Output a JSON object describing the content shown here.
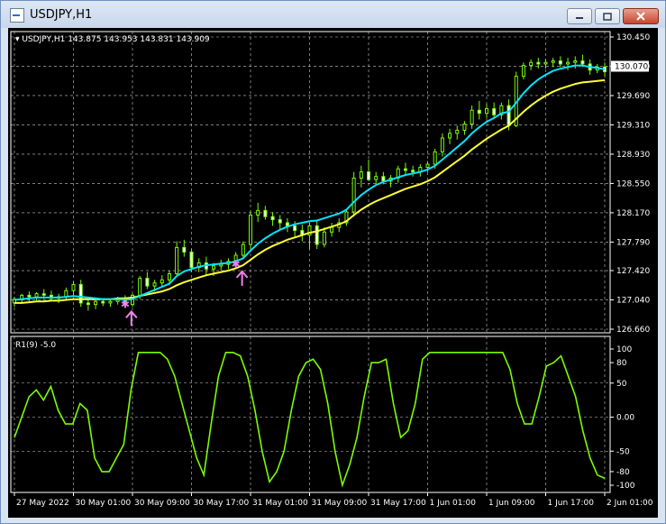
{
  "window": {
    "title": "USDJPY,H1",
    "controls": [
      "minimize",
      "maximize",
      "close"
    ]
  },
  "chart": {
    "info": "USDJPY,H1  143.875 143.953 143.831 143.909",
    "price_ticks": [
      "130.450",
      "130.070",
      "129.690",
      "129.310",
      "128.930",
      "128.550",
      "128.170",
      "127.790",
      "127.420",
      "127.040",
      "126.660"
    ],
    "current_price": "130.070",
    "indicator_label": "R1(9) -5.0",
    "indicator_ticks": [
      "100",
      "80",
      "50",
      "0.00",
      "-50",
      "-80",
      "-100"
    ],
    "time_ticks": [
      "27 May 2022",
      "30 May 01:00",
      "30 May 09:00",
      "30 May 17:00",
      "31 May 01:00",
      "31 May 09:00",
      "31 May 17:00",
      "1 Jun 01:00",
      "1 Jun 09:00",
      "1 Jun 17:00",
      "2 Jun 01:00"
    ],
    "colors": {
      "background": "#000000",
      "grid": "#c8c8c8",
      "candle": "#7cfc00",
      "ma_fast": "#00e5ff",
      "ma_slow": "#ffff33",
      "signal": "#ee82ee",
      "indicator_line": "#7cfc00"
    },
    "signals": [
      {
        "type": "buy-arrow",
        "near": "30 May 09:00"
      },
      {
        "type": "buy-arrow",
        "near": "30 May 17:00"
      }
    ]
  },
  "chart_data": {
    "type": "candlestick",
    "symbol": "USDJPY",
    "timeframe": "H1",
    "ylim": [
      126.66,
      130.45
    ],
    "ohlc": [
      [
        127.0,
        127.08,
        126.95,
        127.05
      ],
      [
        127.05,
        127.12,
        127.0,
        127.1
      ],
      [
        127.1,
        127.15,
        127.02,
        127.08
      ],
      [
        127.08,
        127.14,
        127.03,
        127.12
      ],
      [
        127.12,
        127.18,
        127.05,
        127.1
      ],
      [
        127.1,
        127.16,
        127.02,
        127.06
      ],
      [
        127.06,
        127.12,
        127.0,
        127.08
      ],
      [
        127.08,
        127.2,
        127.04,
        127.16
      ],
      [
        127.16,
        127.28,
        127.1,
        127.24
      ],
      [
        127.24,
        127.3,
        126.95,
        127.0
      ],
      [
        127.0,
        127.06,
        126.9,
        126.98
      ],
      [
        126.98,
        127.05,
        126.92,
        127.02
      ],
      [
        127.02,
        127.06,
        126.96,
        127.0
      ],
      [
        127.0,
        127.05,
        126.95,
        127.02
      ],
      [
        127.02,
        127.08,
        126.98,
        127.04
      ],
      [
        127.04,
        127.1,
        126.96,
        126.98
      ],
      [
        126.98,
        127.12,
        126.95,
        127.1
      ],
      [
        127.1,
        127.35,
        127.05,
        127.32
      ],
      [
        127.32,
        127.4,
        127.18,
        127.22
      ],
      [
        127.22,
        127.3,
        127.15,
        127.26
      ],
      [
        127.26,
        127.36,
        127.2,
        127.3
      ],
      [
        127.3,
        127.42,
        127.24,
        127.38
      ],
      [
        127.38,
        127.8,
        127.34,
        127.72
      ],
      [
        127.72,
        127.82,
        127.6,
        127.66
      ],
      [
        127.66,
        127.7,
        127.4,
        127.46
      ],
      [
        127.46,
        127.58,
        127.4,
        127.52
      ],
      [
        127.52,
        127.6,
        127.36,
        127.44
      ],
      [
        127.44,
        127.52,
        127.35,
        127.48
      ],
      [
        127.48,
        127.56,
        127.42,
        127.5
      ],
      [
        127.5,
        127.58,
        127.44,
        127.54
      ],
      [
        127.54,
        127.66,
        127.48,
        127.62
      ],
      [
        127.62,
        127.8,
        127.58,
        127.76
      ],
      [
        127.76,
        128.2,
        127.7,
        128.14
      ],
      [
        128.14,
        128.3,
        128.05,
        128.2
      ],
      [
        128.2,
        128.26,
        128.08,
        128.12
      ],
      [
        128.12,
        128.18,
        128.0,
        128.08
      ],
      [
        128.08,
        128.14,
        127.96,
        128.04
      ],
      [
        128.04,
        128.1,
        127.92,
        128.0
      ],
      [
        128.0,
        128.06,
        127.86,
        127.94
      ],
      [
        127.94,
        128.02,
        127.8,
        127.88
      ],
      [
        127.88,
        128.04,
        127.7,
        128.0
      ],
      [
        128.0,
        128.06,
        127.7,
        127.76
      ],
      [
        127.76,
        127.98,
        127.72,
        127.92
      ],
      [
        127.92,
        128.04,
        127.86,
        127.98
      ],
      [
        127.98,
        128.1,
        127.92,
        128.04
      ],
      [
        128.04,
        128.22,
        128.0,
        128.18
      ],
      [
        128.18,
        128.7,
        128.12,
        128.62
      ],
      [
        128.62,
        128.78,
        128.5,
        128.7
      ],
      [
        128.7,
        128.86,
        128.58,
        128.6
      ],
      [
        128.6,
        128.7,
        128.52,
        128.64
      ],
      [
        128.64,
        128.7,
        128.54,
        128.58
      ],
      [
        128.58,
        128.66,
        128.5,
        128.62
      ],
      [
        128.62,
        128.78,
        128.56,
        128.74
      ],
      [
        128.74,
        128.82,
        128.66,
        128.72
      ],
      [
        128.72,
        128.78,
        128.64,
        128.7
      ],
      [
        128.7,
        128.8,
        128.64,
        128.76
      ],
      [
        128.76,
        128.84,
        128.7,
        128.8
      ],
      [
        128.8,
        129.0,
        128.74,
        128.96
      ],
      [
        128.96,
        129.2,
        128.9,
        129.14
      ],
      [
        129.14,
        129.26,
        129.06,
        129.2
      ],
      [
        129.2,
        129.3,
        129.12,
        129.24
      ],
      [
        129.24,
        129.36,
        129.18,
        129.32
      ],
      [
        129.32,
        129.56,
        129.26,
        129.5
      ],
      [
        129.5,
        129.62,
        129.38,
        129.46
      ],
      [
        129.46,
        129.58,
        129.4,
        129.52
      ],
      [
        129.52,
        129.6,
        129.4,
        129.44
      ],
      [
        129.44,
        129.6,
        129.38,
        129.56
      ],
      [
        129.56,
        129.64,
        129.24,
        129.3
      ],
      [
        129.3,
        130.0,
        129.28,
        129.94
      ],
      [
        129.94,
        130.12,
        129.9,
        130.08
      ],
      [
        130.08,
        130.16,
        130.02,
        130.12
      ],
      [
        130.12,
        130.18,
        130.04,
        130.1
      ],
      [
        130.1,
        130.16,
        130.04,
        130.12
      ],
      [
        130.12,
        130.18,
        130.06,
        130.14
      ],
      [
        130.14,
        130.2,
        130.06,
        130.1
      ],
      [
        130.1,
        130.18,
        130.02,
        130.12
      ],
      [
        130.12,
        130.2,
        130.04,
        130.14
      ],
      [
        130.14,
        130.22,
        130.06,
        130.1
      ],
      [
        130.1,
        130.16,
        129.96,
        130.02
      ],
      [
        130.02,
        130.1,
        129.98,
        130.06
      ],
      [
        130.06,
        130.12,
        129.94,
        130.0
      ]
    ],
    "ma_fast": [
      127.04,
      127.05,
      127.06,
      127.07,
      127.07,
      127.07,
      127.07,
      127.08,
      127.09,
      127.08,
      127.07,
      127.06,
      127.05,
      127.05,
      127.05,
      127.04,
      127.05,
      127.09,
      127.13,
      127.17,
      127.21,
      127.25,
      127.35,
      127.41,
      127.44,
      127.47,
      127.49,
      127.5,
      127.51,
      127.52,
      127.54,
      127.58,
      127.68,
      127.77,
      127.84,
      127.9,
      127.95,
      127.99,
      128.02,
      128.04,
      128.06,
      128.07,
      128.1,
      128.13,
      128.16,
      128.21,
      128.31,
      128.4,
      128.47,
      128.53,
      128.57,
      128.6,
      128.63,
      128.66,
      128.68,
      128.7,
      128.73,
      128.78,
      128.86,
      128.94,
      129.02,
      129.1,
      129.2,
      129.28,
      129.35,
      129.4,
      129.46,
      129.48,
      129.6,
      129.72,
      129.82,
      129.9,
      129.96,
      130.01,
      130.04,
      130.06,
      130.08,
      130.08,
      130.06,
      130.05,
      130.03
    ],
    "ma_slow": [
      127.0,
      127.0,
      127.01,
      127.02,
      127.02,
      127.03,
      127.03,
      127.04,
      127.05,
      127.05,
      127.05,
      127.05,
      127.05,
      127.05,
      127.06,
      127.06,
      127.07,
      127.09,
      127.11,
      127.13,
      127.15,
      127.18,
      127.23,
      127.27,
      127.3,
      127.33,
      127.36,
      127.38,
      127.4,
      127.42,
      127.45,
      127.49,
      127.56,
      127.63,
      127.69,
      127.74,
      127.78,
      127.82,
      127.85,
      127.88,
      127.91,
      127.93,
      127.96,
      127.99,
      128.02,
      128.06,
      128.14,
      128.21,
      128.27,
      128.32,
      128.36,
      128.4,
      128.44,
      128.48,
      128.51,
      128.54,
      128.58,
      128.63,
      128.7,
      128.77,
      128.84,
      128.91,
      128.99,
      129.06,
      129.13,
      129.19,
      129.25,
      129.3,
      129.39,
      129.48,
      129.56,
      129.63,
      129.69,
      129.74,
      129.78,
      129.81,
      129.84,
      129.86,
      129.87,
      129.88,
      129.89
    ],
    "indicator": {
      "name": "R1(9)",
      "value": -5.0,
      "ylim": [
        -100,
        100
      ],
      "values": [
        -30,
        0,
        30,
        40,
        25,
        45,
        10,
        -10,
        -10,
        20,
        10,
        -60,
        -80,
        -80,
        -60,
        -40,
        40,
        95,
        95,
        95,
        95,
        85,
        60,
        20,
        -20,
        -60,
        -85,
        -10,
        60,
        95,
        95,
        90,
        60,
        10,
        -50,
        -95,
        -80,
        -50,
        10,
        60,
        80,
        85,
        70,
        20,
        -50,
        -100,
        -70,
        -30,
        30,
        80,
        80,
        85,
        20,
        -30,
        -20,
        20,
        85,
        95,
        95,
        95,
        95,
        95,
        95,
        95,
        95,
        95,
        95,
        95,
        70,
        20,
        -10,
        -10,
        30,
        75,
        80,
        90,
        60,
        30,
        -20,
        -60,
        -85,
        -90
      ]
    }
  }
}
